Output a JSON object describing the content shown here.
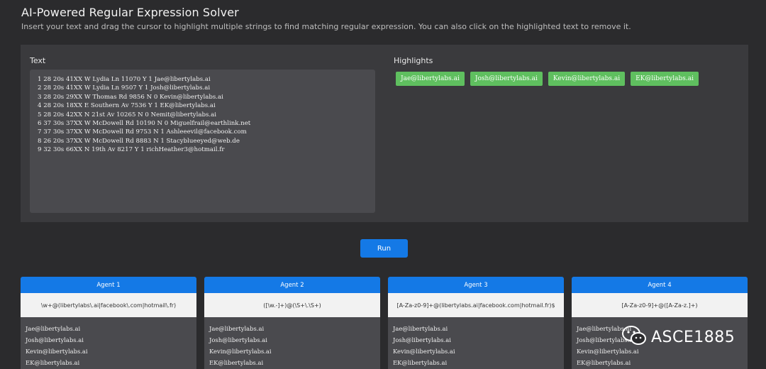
{
  "header": {
    "title": "AI-Powered Regular Expression Solver",
    "subtitle": "Insert your text and drag the cursor to highlight multiple strings to find matching regular expression. You can also click on the highlighted text to remove it."
  },
  "input_panel": {
    "text_label": "Text",
    "text_value": "1 28 20s 41XX W Lydia Ln 11070 Y 1 Jae@libertylabs.ai\n2 28 20s 41XX W Lydia Ln 9507 Y 1 Josh@libertylabs.ai\n3 28 20s 29XX W Thomas Rd 9856 N 0 Kevin@libertylabs.ai\n4 28 20s 18XX E Southern Av 7536 Y 1 EK@libertylabs.ai\n5 28 20s 42XX N 21st Av 10265 N 0 Nemit@libertylabs.ai\n6 37 30s 37XX W McDowell Rd 10190 N 0 Miguelfrail@earthlink.net\n7 37 30s 37XX W McDowell Rd 9753 N 1 Ashleeevil@facebook.com\n8 26 20s 37XX W McDowell Rd 8883 N 1 Stacyblueeyed@web.de\n9 32 30s 66XX N 19th Av 8217 Y 1 richHeather3@hotmail.fr",
    "highlights_label": "Highlights",
    "highlights": [
      "Jae@libertylabs.ai",
      "Josh@libertylabs.ai",
      "Kevin@libertylabs.ai",
      "EK@libertylabs.ai"
    ]
  },
  "run_button": {
    "label": "Run"
  },
  "agents": [
    {
      "title": "Agent 1",
      "regex": "\\w+@(libertylabs\\.ai|facebook\\.com|hotmail\\.fr)",
      "results": [
        "Jae@libertylabs.ai",
        "Josh@libertylabs.ai",
        "Kevin@libertylabs.ai",
        "EK@libertylabs.ai"
      ]
    },
    {
      "title": "Agent 2",
      "regex": "([\\w.-]+)@(\\S+\\.\\S+)",
      "results": [
        "Jae@libertylabs.ai",
        "Josh@libertylabs.ai",
        "Kevin@libertylabs.ai",
        "EK@libertylabs.ai"
      ]
    },
    {
      "title": "Agent 3",
      "regex": "[A-Za-z0-9]+@(libertylabs.ai|facebook.com|hotmail.fr)$",
      "results": [
        "Jae@libertylabs.ai",
        "Josh@libertylabs.ai",
        "Kevin@libertylabs.ai",
        "EK@libertylabs.ai"
      ]
    },
    {
      "title": "Agent 4",
      "regex": "[A-Za-z0-9]+@([A-Za-z.]+)",
      "results": [
        "Jae@libertylabs.ai",
        "Josh@libertylabs.ai",
        "Kevin@libertylabs.ai",
        "EK@libertylabs.ai"
      ]
    }
  ],
  "watermark": {
    "text": "ASCE1885",
    "icon": "wechat-icon"
  }
}
